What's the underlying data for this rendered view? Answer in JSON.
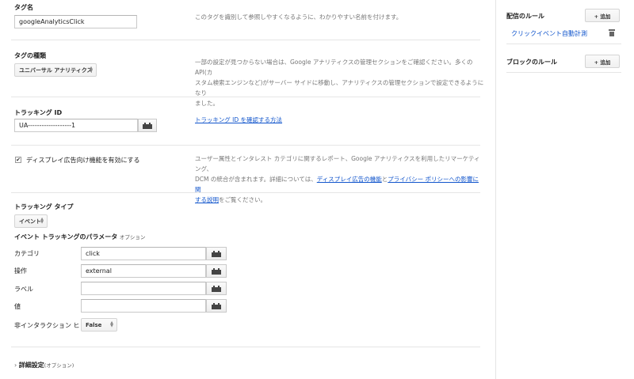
{
  "tag_name": {
    "label": "タグ名",
    "value": "googleAnalyticsClick",
    "help": "このタグを識別して参照しやすくなるように、わかりやすい名前を付けます。"
  },
  "tag_type": {
    "label": "タグの種類",
    "selected": "ユニバーサル アナリティクス",
    "help_line1": "一部の設定が見つからない場合は、Google アナリティクスの管理セクションをご確認ください。多くの API(カ",
    "help_line2": "スタム検索エンジンなど)がサーバー サイドに移動し、アナリティクスの管理セクションで設定できるようになり",
    "help_line3": "ました。"
  },
  "tracking_id": {
    "label": "トラッキング ID",
    "value": "UA-------------------1",
    "help_link": "トラッキング ID を確認する方法"
  },
  "display_ads": {
    "checked": true,
    "label": "ディスプレイ広告向け機能を有効にする",
    "help_line1": "ユーザー属性とインタレスト カテゴリに関するレポート、Google アナリティクスを利用したリマーケティング、",
    "help_line2_pre": "DCM の統合が含まれます。詳細については、",
    "help_link1": "ディスプレイ広告の機能",
    "help_mid": "と",
    "help_link2a": "プライバシー ポリシーへの影響に関",
    "help_link2b": "する説明",
    "help_post": "をご覧ください。"
  },
  "tracking_type": {
    "label": "トラッキング タイプ",
    "selected": "イベント"
  },
  "event_params": {
    "heading": "イベント トラッキングのパラメータ",
    "optional": "オプション",
    "rows": [
      {
        "label": "カテゴリ",
        "value": "click"
      },
      {
        "label": "操作",
        "value": "external"
      },
      {
        "label": "ラベル",
        "value": ""
      },
      {
        "label": "値",
        "value": ""
      }
    ],
    "non_interaction_label": "非インタラクション ヒット",
    "non_interaction_value": "False"
  },
  "advanced": {
    "label": "詳細設定",
    "optional": "(オプション)"
  },
  "sidebar": {
    "firing_rules_title": "配信のルール",
    "add_label": "+ 追加",
    "firing_rule_item": "クリックイベント自動計測",
    "blocking_rules_title": "ブロックのルール"
  }
}
